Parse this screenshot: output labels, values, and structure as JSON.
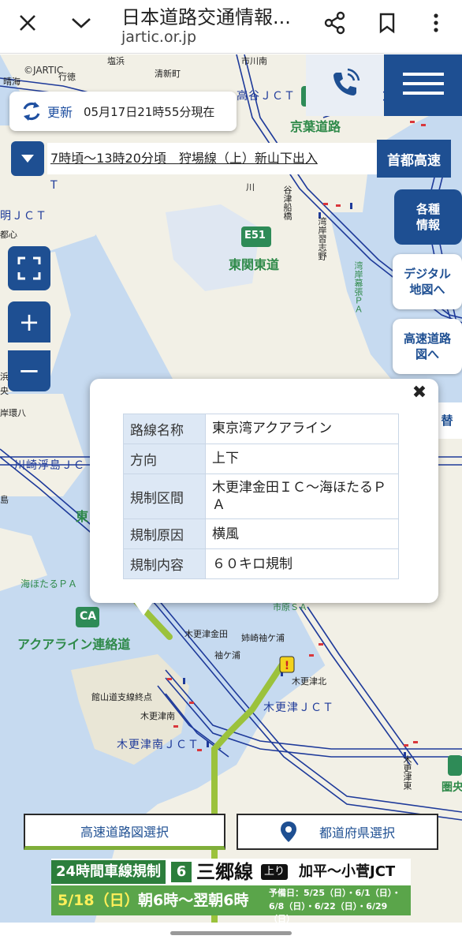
{
  "browser": {
    "title": "日本道路交通情報...",
    "url": "jartic.or.jp"
  },
  "map": {
    "copyright": "©JARTIC",
    "labels": {
      "keiyo": "京葉道路",
      "higashikanto": "東関東道",
      "e51": "E51",
      "aqualine_link": "アクアライン連絡道",
      "ca": "CA",
      "kisarazu_jct": "木更津ＪＣＴ",
      "kisarazu_minami_jct": "木更津南ＪＣＴ",
      "kawasaki_ukishima": "川崎浮島ＪＣ",
      "umihotaru": "海ほたるＰＡ",
      "takaya_jct": "高谷ＪＣＴ",
      "kisarazu_kaneda": "木更津金田",
      "sodegaura_label": "袖ケ浦",
      "anesaki": "姉崎袖ケ浦",
      "kisarazu_kita": "木更津北",
      "kisarazu_minami": "木更津南",
      "kisarazu_higashi": "木更津東",
      "tateyama": "館山道支線終点",
      "wangan_narashino": "湾岸習志野",
      "wangan_makuhari": "湾岸幕張ＰＡ",
      "yatsu": "谷津船橋",
      "shioiri": "塩浜",
      "seitoku": "清新町",
      "ichikawa": "市川南",
      "ichikawa2": "行徳",
      "harumi": "晴海",
      "shi": "市原ＳＡ",
      "ken": "圏央",
      "yoko": "東",
      "ch_jct": "明ＪＣＴ",
      "wan": "川",
      "c": "C",
      "t": "T",
      "shin": "都心",
      "shima": "島",
      "oo": "央",
      "hama": "浜",
      "riha": "岸環八"
    }
  },
  "update": {
    "label": "更新",
    "time": "05月17日21時55分現在"
  },
  "ticker": {
    "text": "7時頃～13時20分頃　狩場線（上）新山下出入",
    "road_button": "首都高速"
  },
  "side_buttons": {
    "various": "各種情報",
    "various_l1": "各種",
    "various_l2": "情報",
    "digital_l1": "デジタル",
    "digital_l2": "地図へ",
    "highway_l1": "高速道路",
    "highway_l2": "図へ",
    "switch": "替"
  },
  "map_controls": {
    "zoom_in": "+",
    "zoom_out": "−"
  },
  "popup": {
    "close": "✖",
    "rows": [
      {
        "key": "路線名称",
        "value": "東京湾アクアライン"
      },
      {
        "key": "方向",
        "value": "上下"
      },
      {
        "key": "規制区間",
        "value": "木更津金田ＩＣ～海ほたるＰＡ"
      },
      {
        "key": "規制原因",
        "value": "横風"
      },
      {
        "key": "規制内容",
        "value": "６０キロ規制"
      }
    ]
  },
  "bottom_buttons": {
    "highway_select": "高速道路図選択",
    "prefecture_select": "都道府県選択"
  },
  "banner": {
    "badge": "24時間車線規制",
    "route_no": "6",
    "route": "三郷線",
    "direction": "上り",
    "section": "加平～小菅JCT",
    "date": "5/18（日）",
    "hours": "朝6時～翌朝6時",
    "schedule_l1": "予備日：5/25（日）・6/1（日）・",
    "schedule_l2": "6/8（日）・6/22（日）・6/29（日）"
  },
  "colors": {
    "primary": "#1e4f92",
    "sea": "#c6daf0",
    "land": "#f2f0e6",
    "road_green": "#9bc23c",
    "banner_green": "#5aa54a"
  }
}
